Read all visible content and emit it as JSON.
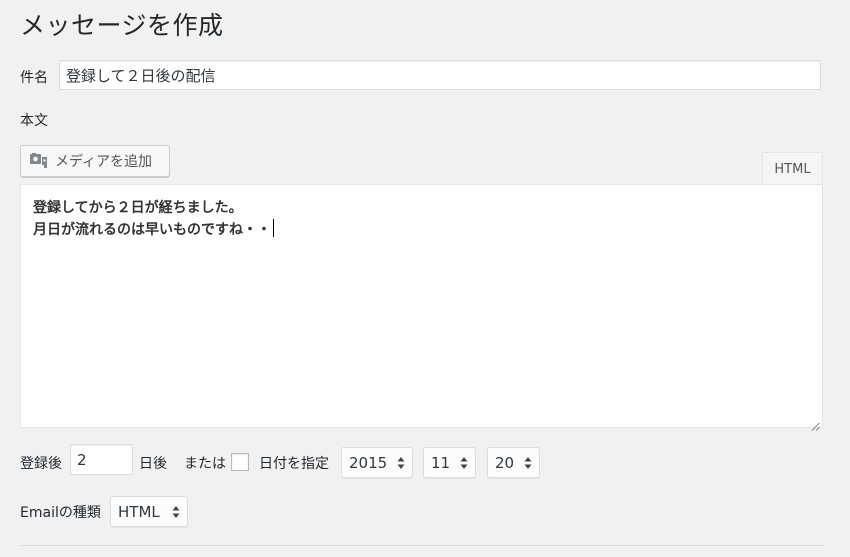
{
  "page": {
    "title": "メッセージを作成"
  },
  "subject": {
    "label": "件名",
    "value": "登録して２日後の配信"
  },
  "body": {
    "label": "本文",
    "media_button": "メディアを追加",
    "html_tab": "HTML",
    "lines": [
      "登録してから２日が経ちました。",
      "月日が流れるのは早いものですね・・"
    ]
  },
  "schedule": {
    "after_label": "登録後",
    "days_value": "2",
    "days_unit": "日後",
    "or_label": "または",
    "date_label": "日付を指定",
    "year": "2015",
    "month": "11",
    "day": "20"
  },
  "email_type": {
    "label": "Emailの種類",
    "value": "HTML"
  }
}
